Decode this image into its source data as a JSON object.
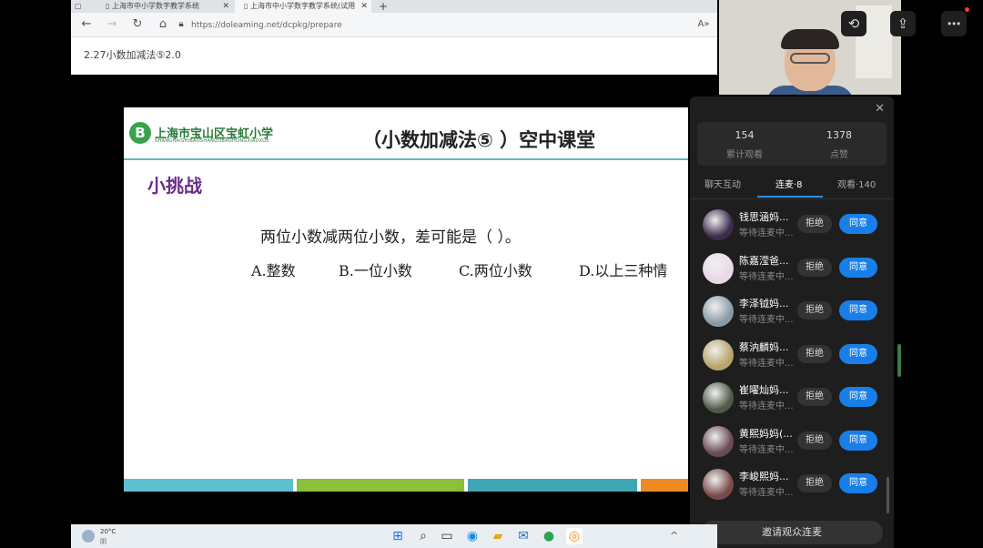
{
  "browser": {
    "tabs": [
      {
        "label": "上海市中小学数字教学系统"
      },
      {
        "label": "上海市中小学数字教学系统(试用"
      }
    ],
    "url": "https://doleaming.net/dcpkg/prepare",
    "breadcrumb": "2.27小数加减法⑤2.0"
  },
  "slide": {
    "logo_text": "上海市宝山区宝虹小学",
    "logo_sub": "SHANGHAISHIBAOSHANQUBAOHONGXIAOXUE",
    "title": "（小数加减法⑤ ）空中课堂",
    "section": "小挑战",
    "question": "两位小数减两位小数，差可能是（       ）。",
    "options": [
      "A.整数",
      "B.一位小数",
      "C.两位小数",
      "D.以上三种情"
    ],
    "band_colors": [
      "#5cc0cf",
      "#8cbf3a",
      "#3fa6b3",
      "#f08a24"
    ]
  },
  "panel": {
    "stats": [
      {
        "value": "154",
        "label": "累计观看"
      },
      {
        "value": "1378",
        "label": "点赞"
      }
    ],
    "tabs": [
      {
        "label": "聊天互动"
      },
      {
        "label": "连麦·8",
        "active": true
      },
      {
        "label": "观看·140"
      }
    ],
    "requests": [
      {
        "name": "钱思涵妈...",
        "status": "等待连麦中...",
        "avatar_color": "#3b2b4d"
      },
      {
        "name": "陈嘉滢爸...",
        "status": "等待连麦中...",
        "avatar_color": "#e9d9e8"
      },
      {
        "name": "李泽钺妈...",
        "status": "等待连麦中...",
        "avatar_color": "#8a9aa8"
      },
      {
        "name": "蔡汭麟妈...",
        "status": "等待连麦中...",
        "avatar_color": "#b8a56a"
      },
      {
        "name": "崔曜灿妈...",
        "status": "等待连麦中...",
        "avatar_color": "#4f5a4a"
      },
      {
        "name": "黄熙妈妈(...",
        "status": "等待连麦中...",
        "avatar_color": "#6a4a55"
      },
      {
        "name": "李峻熙妈...",
        "status": "等待连麦中...",
        "avatar_color": "#7a4a4a"
      }
    ],
    "reject_label": "拒绝",
    "accept_label": "同意",
    "invite_label": "邀请观众连麦"
  },
  "taskbar": {
    "temperature": "20°C",
    "condition": "阴"
  }
}
